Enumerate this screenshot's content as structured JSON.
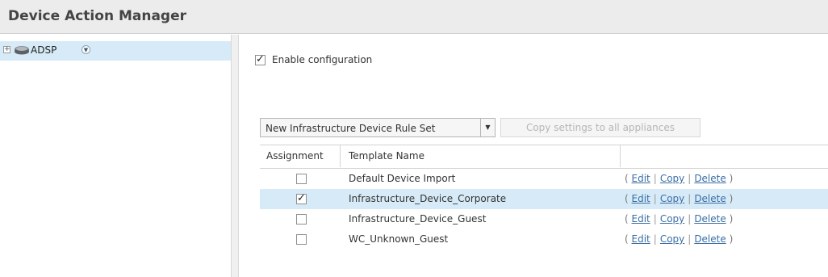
{
  "header": {
    "title": "Device Action Manager"
  },
  "tree": {
    "root_label": "ADSP"
  },
  "config": {
    "enable_label": "Enable configuration",
    "enabled": true
  },
  "toolbar": {
    "new_rule_set_label": "New Infrastructure Device Rule Set",
    "copy_settings_label": "Copy settings to all appliances"
  },
  "table": {
    "columns": [
      "Assignment",
      "Template Name"
    ],
    "rows": [
      {
        "assigned": false,
        "name": "Default Device Import",
        "selected": false
      },
      {
        "assigned": true,
        "name": "Infrastructure_Device_Corporate",
        "selected": true
      },
      {
        "assigned": false,
        "name": "Infrastructure_Device_Guest",
        "selected": false
      },
      {
        "assigned": false,
        "name": "WC_Unknown_Guest",
        "selected": false
      }
    ],
    "actions": {
      "open": "(",
      "edit": "Edit",
      "copy": "Copy",
      "delete": "Delete",
      "close": ")"
    }
  },
  "colors": {
    "selection": "#d6ebf7",
    "link": "#3a6ea5",
    "header_bg": "#ececec"
  }
}
